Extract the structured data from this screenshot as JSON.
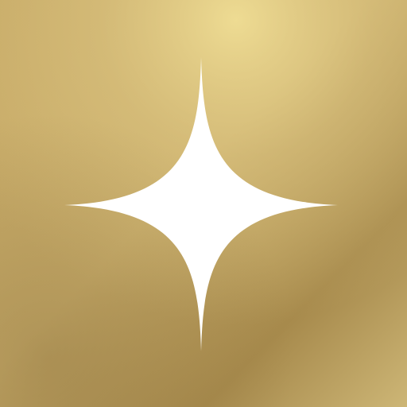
{
  "icon": {
    "glyph": "four-point-sparkle-icon",
    "colors": {
      "gold_light": "#ead78f",
      "gold_mid": "#c9ad6a",
      "gold_deep": "#a78a4c",
      "gold_bottom_right": "#cdb676",
      "sparkle": "#ffffff"
    }
  }
}
